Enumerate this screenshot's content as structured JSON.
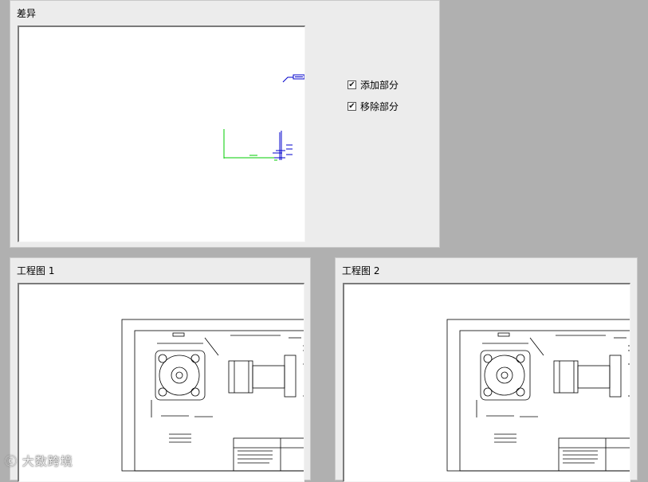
{
  "diff_panel": {
    "title": "差异",
    "options": [
      {
        "label": "添加部分",
        "checked": true,
        "mark": "✔"
      },
      {
        "label": "移除部分",
        "checked": true,
        "mark": "✔"
      }
    ]
  },
  "drawing1": {
    "title": "工程图 1"
  },
  "drawing2": {
    "title": "工程图 2"
  },
  "watermark": {
    "text": "大数跨境"
  },
  "colors": {
    "added": "#00cc00",
    "removed": "#0000cc",
    "drawing_line": "#000000"
  }
}
